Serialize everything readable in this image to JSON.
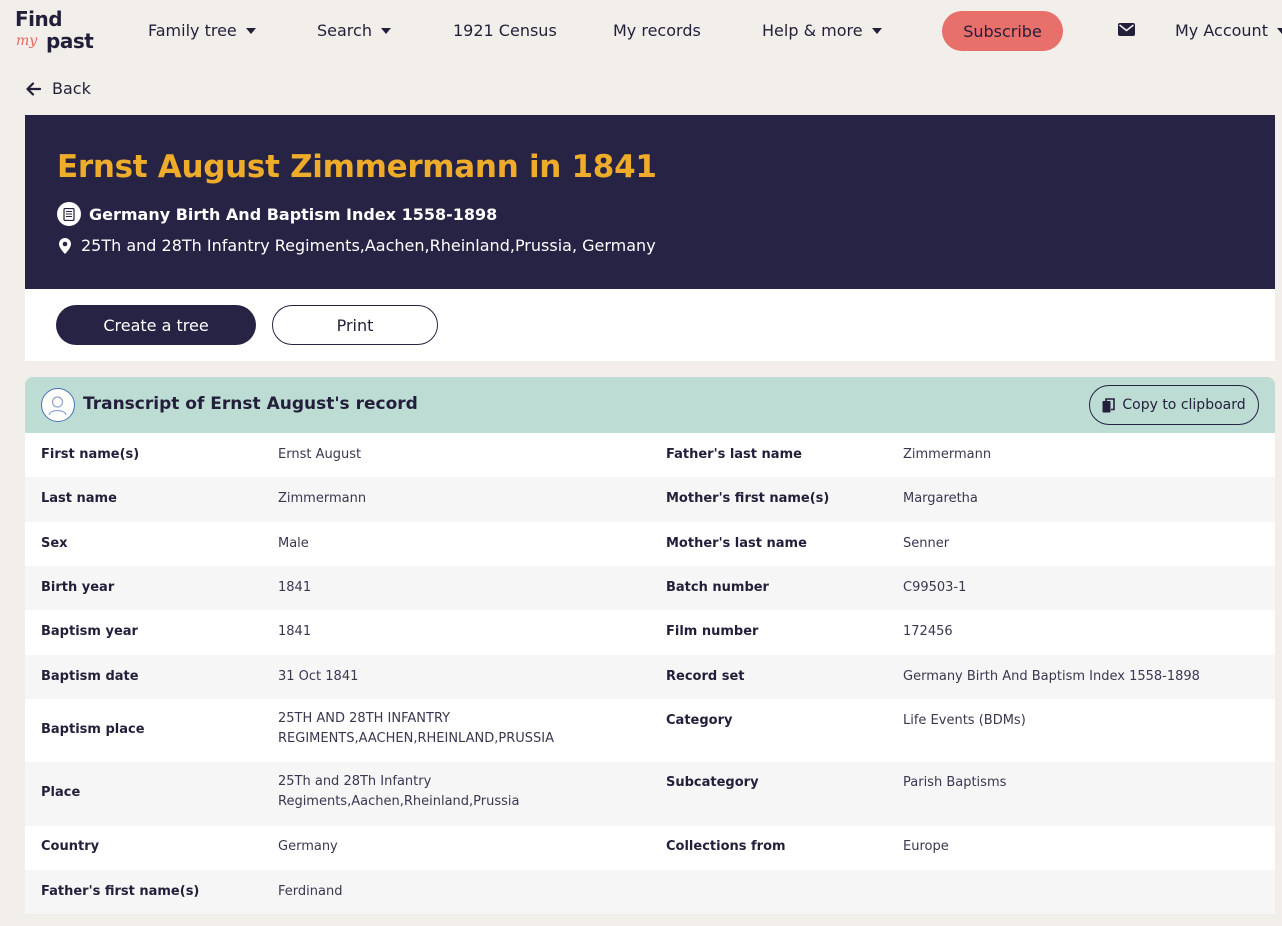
{
  "nav": {
    "logo": {
      "find": "Find",
      "my": "my",
      "past": "past"
    },
    "items": [
      {
        "label": "Family tree",
        "dropdown": true
      },
      {
        "label": "Search",
        "dropdown": true
      },
      {
        "label": "1921 Census",
        "dropdown": false
      },
      {
        "label": "My records",
        "dropdown": false
      },
      {
        "label": "Help & more",
        "dropdown": true
      }
    ],
    "subscribe": "Subscribe",
    "mail_icon": "envelope-icon",
    "account": "My Account"
  },
  "back_label": "Back",
  "hero": {
    "title": "Ernst August Zimmermann in 1841",
    "record_set": "Germany Birth And Baptism Index 1558-1898",
    "location": "25Th and 28Th Infantry Regiments,Aachen,Rheinland,Prussia, Germany"
  },
  "actions": {
    "create_tree": "Create a tree",
    "print": "Print"
  },
  "transcript": {
    "title": "Transcript of Ernst August's record",
    "copy_label": "Copy to clipboard",
    "rows": [
      {
        "l1": "First name(s)",
        "v1": "Ernst August",
        "l2": "Father's last name",
        "v2": "Zimmermann"
      },
      {
        "l1": "Last name",
        "v1": "Zimmermann",
        "l2": "Mother's first name(s)",
        "v2": "Margaretha"
      },
      {
        "l1": "Sex",
        "v1": "Male",
        "l2": "Mother's last name",
        "v2": "Senner"
      },
      {
        "l1": "Birth year",
        "v1": "1841",
        "l2": "Batch number",
        "v2": "C99503-1"
      },
      {
        "l1": "Baptism year",
        "v1": "1841",
        "l2": "Film number",
        "v2": "172456"
      },
      {
        "l1": "Baptism date",
        "v1": "31 Oct 1841",
        "l2": "Record set",
        "v2": "Germany Birth And Baptism Index 1558-1898"
      },
      {
        "l1": "Baptism place",
        "v1": [
          "25TH AND 28TH INFANTRY",
          "REGIMENTS,AACHEN,RHEINLAND,PRUSSIA"
        ],
        "l2": "Category",
        "v2": "Life Events (BDMs)"
      },
      {
        "l1": "Place",
        "v1": [
          "25Th and 28Th Infantry",
          "Regiments,Aachen,Rheinland,Prussia"
        ],
        "l2": "Subcategory",
        "v2": "Parish Baptisms"
      },
      {
        "l1": "Country",
        "v1": "Germany",
        "l2": "Collections from",
        "v2": "Europe"
      },
      {
        "l1": "Father's first name(s)",
        "v1": "Ferdinand",
        "l2": "",
        "v2": ""
      }
    ]
  }
}
